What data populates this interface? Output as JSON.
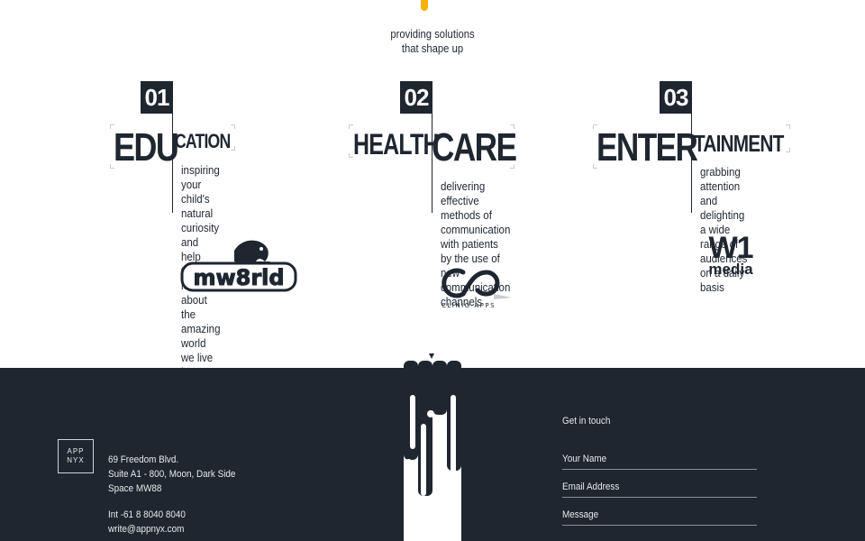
{
  "tagline": [
    "providing solutions",
    "that shape up"
  ],
  "sectors": [
    {
      "number": "01",
      "word_big": "EDU",
      "word_small": "CATION",
      "description": [
        "inspiring your child's",
        "natural curiosity and",
        "help them learn about",
        "the amazing world",
        "we live in"
      ],
      "logo": "mworld-logo"
    },
    {
      "number": "02",
      "word_big": "HEALTH",
      "word_small": "CARE",
      "description": [
        "delivering effective",
        "methods of communication",
        "with patients by the use of",
        "new communication",
        "channels"
      ],
      "logo": "clinio-apps-logo",
      "logo_text": "CLINIO APPS"
    },
    {
      "number": "03",
      "word_big": "ENTER",
      "word_small": "TAINMENT",
      "description": [
        "grabbing attention",
        "and delighting a wide",
        "range of audiences",
        "on a daily basis"
      ],
      "logo": "w1-media-logo",
      "logo_text": [
        "W1",
        "media"
      ]
    }
  ],
  "footer": {
    "brand": [
      "APP",
      "NYX"
    ],
    "address": [
      "69 Freedom Blvd.",
      "Suite A1 - 800, Moon, Dark Side",
      "Space MW88"
    ],
    "phone": "Int -61 8 8040 8040",
    "email": "write@appnyx.com",
    "contact_title": "Get in touch",
    "fields": [
      "Your Name",
      "Email Address",
      "Message"
    ]
  },
  "colors": {
    "dark": "#1f2630",
    "accent": "#f6b10a",
    "white": "#ffffff"
  }
}
